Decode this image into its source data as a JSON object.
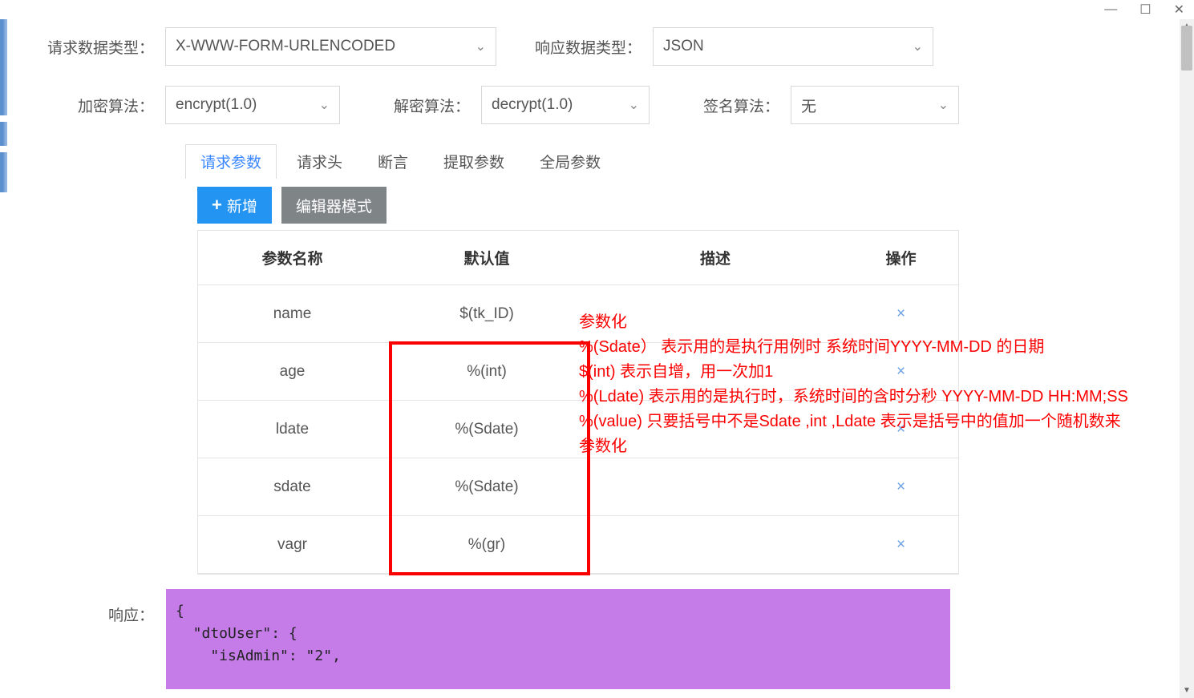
{
  "titlebar": {
    "min": "—",
    "max": "☐",
    "close": "✕"
  },
  "form": {
    "req_type_label": "请求数据类型：",
    "req_type_value": "X-WWW-FORM-URLENCODED",
    "res_type_label": "响应数据类型：",
    "res_type_value": "JSON",
    "encrypt_label": "加密算法：",
    "encrypt_value": "encrypt(1.0)",
    "decrypt_label": "解密算法：",
    "decrypt_value": "decrypt(1.0)",
    "sign_label": "签名算法：",
    "sign_value": "无"
  },
  "tabs": [
    {
      "label": "请求参数",
      "active": true
    },
    {
      "label": "请求头",
      "active": false
    },
    {
      "label": "断言",
      "active": false
    },
    {
      "label": "提取参数",
      "active": false
    },
    {
      "label": "全局参数",
      "active": false
    }
  ],
  "buttons": {
    "add": "新增",
    "editor": "编辑器模式"
  },
  "table": {
    "headers": {
      "name": "参数名称",
      "default": "默认值",
      "desc": "描述",
      "action": "操作"
    },
    "rows": [
      {
        "name": "name",
        "default": "$(tk_ID)",
        "desc": ""
      },
      {
        "name": "age",
        "default": "%(int)",
        "desc": ""
      },
      {
        "name": "ldate",
        "default": "%(Sdate)",
        "desc": ""
      },
      {
        "name": "sdate",
        "default": "%(Sdate)",
        "desc": ""
      },
      {
        "name": "vagr",
        "default": "%(gr)",
        "desc": ""
      }
    ],
    "delete_glyph": "×"
  },
  "annotation": {
    "line1": "参数化",
    "line2": "%(Sdate） 表示用的是执行用例时  系统时间YYYY-MM-DD 的日期",
    "line3": "$(int)  表示自增，用一次加1",
    "line4": "%(Ldate)  表示用的是执行时，系统时间的含时分秒  YYYY-MM-DD HH:MM;SS",
    "line5": "%(value)  只要括号中不是Sdate ,int ,Ldate 表示是括号中的值加一个随机数来参数化"
  },
  "response": {
    "label": "响应：",
    "body": "{\n  \"dtoUser\": {\n    \"isAdmin\": \"2\","
  }
}
